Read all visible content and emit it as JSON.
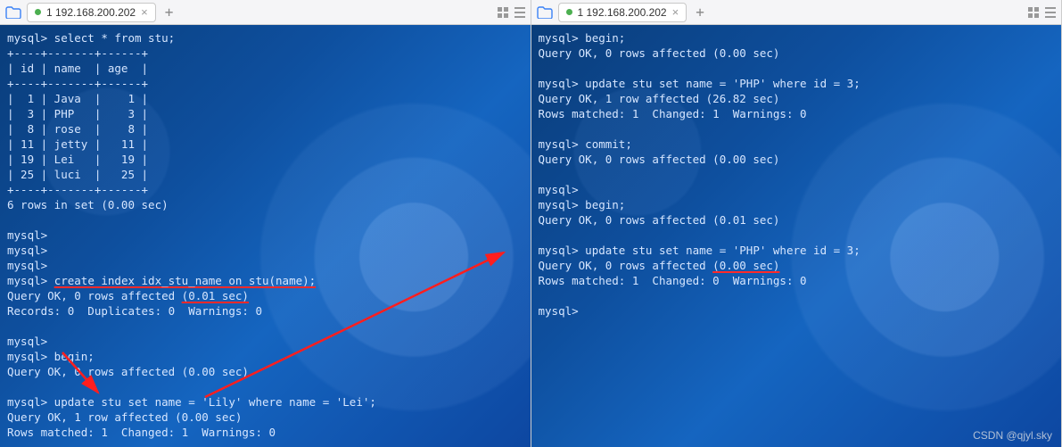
{
  "watermark": "CSDN @qjyl.sky",
  "panes": [
    {
      "tab_label": "1 192.168.200.202",
      "lines": [
        {
          "t": "mysql> select * from stu;"
        },
        {
          "t": "+----+-------+------+"
        },
        {
          "t": "| id | name  | age  |"
        },
        {
          "t": "+----+-------+------+"
        },
        {
          "t": "|  1 | Java  |    1 |"
        },
        {
          "t": "|  3 | PHP   |    3 |"
        },
        {
          "t": "|  8 | rose  |    8 |"
        },
        {
          "t": "| 11 | jetty |   11 |"
        },
        {
          "t": "| 19 | Lei   |   19 |"
        },
        {
          "t": "| 25 | luci  |   25 |"
        },
        {
          "t": "+----+-------+------+"
        },
        {
          "t": "6 rows in set (0.00 sec)"
        },
        {
          "t": ""
        },
        {
          "t": "mysql>"
        },
        {
          "t": "mysql>"
        },
        {
          "t": "mysql>"
        },
        {
          "t": "mysql> create index idx_stu_name on stu(name);",
          "ul": [
            7,
            46
          ]
        },
        {
          "t": "Query OK, 0 rows affected (0.01 sec)",
          "ul": [
            26,
            36
          ]
        },
        {
          "t": "Records: 0  Duplicates: 0  Warnings: 0"
        },
        {
          "t": ""
        },
        {
          "t": "mysql>"
        },
        {
          "t": "mysql> begin;"
        },
        {
          "t": "Query OK, 0 rows affected (0.00 sec)"
        },
        {
          "t": ""
        },
        {
          "t": "mysql> update stu set name = 'Lily' where name = 'Lei';"
        },
        {
          "t": "Query OK, 1 row affected (0.00 sec)"
        },
        {
          "t": "Rows matched: 1  Changed: 1  Warnings: 0"
        }
      ]
    },
    {
      "tab_label": "1 192.168.200.202",
      "lines": [
        {
          "t": "mysql> begin;"
        },
        {
          "t": "Query OK, 0 rows affected (0.00 sec)"
        },
        {
          "t": ""
        },
        {
          "t": "mysql> update stu set name = 'PHP' where id = 3;"
        },
        {
          "t": "Query OK, 1 row affected (26.82 sec)"
        },
        {
          "t": "Rows matched: 1  Changed: 1  Warnings: 0"
        },
        {
          "t": ""
        },
        {
          "t": "mysql> commit;"
        },
        {
          "t": "Query OK, 0 rows affected (0.00 sec)"
        },
        {
          "t": ""
        },
        {
          "t": "mysql>"
        },
        {
          "t": "mysql> begin;"
        },
        {
          "t": "Query OK, 0 rows affected (0.01 sec)"
        },
        {
          "t": ""
        },
        {
          "t": "mysql> update stu set name = 'PHP' where id = 3;"
        },
        {
          "t": "Query OK, 0 rows affected (0.00 sec)",
          "ul": [
            26,
            36
          ]
        },
        {
          "t": "Rows matched: 1  Changed: 0  Warnings: 0"
        },
        {
          "t": ""
        },
        {
          "t": "mysql>"
        }
      ]
    }
  ]
}
